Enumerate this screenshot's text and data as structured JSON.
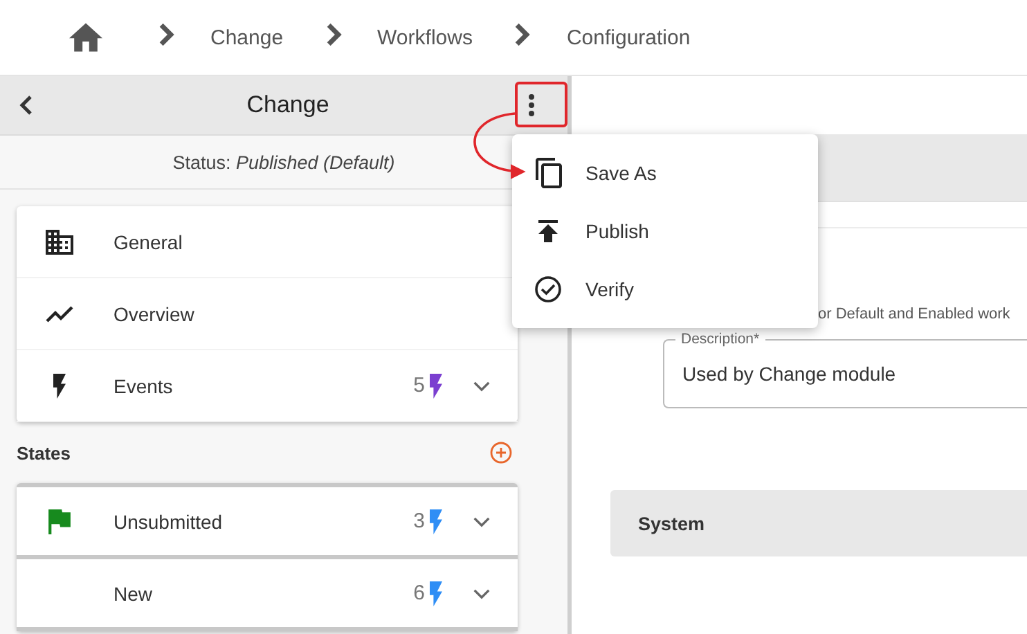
{
  "breadcrumb": [
    {
      "label": "Change"
    },
    {
      "label": "Workflows"
    },
    {
      "label": "Configuration"
    }
  ],
  "panel": {
    "title": "Change",
    "status": "Status: *Published (Default)*"
  },
  "nav_items": [
    {
      "label": "General",
      "kind": "building"
    },
    {
      "label": "Overview",
      "kind": "trend"
    },
    {
      "label": "Events",
      "kind": "bolt",
      "count": "5",
      "expanded": false
    }
  ],
  "states_section": {
    "title": "States",
    "items": [
      {
        "label": "Unsubmitted",
        "kind": "start",
        "count": "3",
        "expanded": false
      },
      {
        "label": "New",
        "kind": "plain",
        "count": "6",
        "expanded": false
      }
    ]
  },
  "menu": {
    "items": [
      {
        "label": "Save As",
        "kind": "copy"
      },
      {
        "label": "Publish",
        "kind": "publish"
      },
      {
        "label": "Verify",
        "kind": "verify"
      }
    ]
  },
  "detail": {
    "hint": "or Default and Enabled work",
    "description": {
      "label": "Description*",
      "value": "Used by Change module"
    },
    "section": "System"
  }
}
